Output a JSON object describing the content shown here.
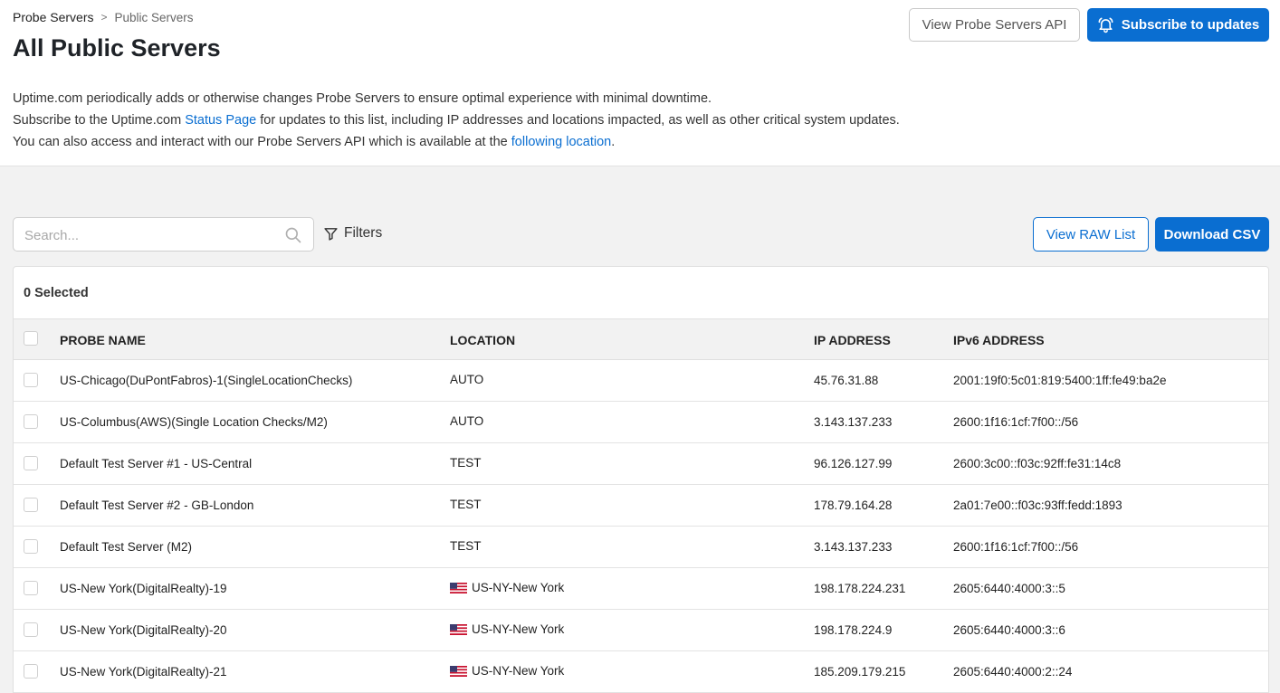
{
  "breadcrumb": {
    "root": "Probe Servers",
    "separator": ">",
    "current": "Public Servers"
  },
  "page_title": "All Public Servers",
  "header_buttons": {
    "api_label": "View Probe Servers API",
    "subscribe_label": "Subscribe to updates",
    "subscribe_icon": "bell-icon"
  },
  "intro": {
    "line1": "Uptime.com periodically adds or otherwise changes Probe Servers to ensure optimal experience with minimal downtime.",
    "line2_prefix": "Subscribe to the Uptime.com ",
    "line2_link": "Status Page",
    "line2_suffix": " for updates to this list, including IP addresses and locations impacted, as well as other critical system updates.",
    "line3_prefix": "You can also access and interact with our Probe Servers API which is available at the ",
    "line3_link": "following location",
    "line3_suffix": "."
  },
  "toolbar": {
    "search_placeholder": "Search...",
    "filters_label": "Filters",
    "raw_list_label": "View RAW List",
    "csv_label": "Download CSV"
  },
  "table": {
    "selected_label": "0 Selected",
    "columns": [
      "PROBE NAME",
      "LOCATION",
      "IP ADDRESS",
      "IPv6 ADDRESS"
    ],
    "rows": [
      {
        "name": "US-Chicago(DuPontFabros)-1(SingleLocationChecks)",
        "location": "AUTO",
        "flag": false,
        "ip": "45.76.31.88",
        "ipv6": "2001:19f0:5c01:819:5400:1ff:fe49:ba2e"
      },
      {
        "name": "US-Columbus(AWS)(Single Location Checks/M2)",
        "location": "AUTO",
        "flag": false,
        "ip": "3.143.137.233",
        "ipv6": "2600:1f16:1cf:7f00::/56"
      },
      {
        "name": "Default Test Server #1 - US-Central",
        "location": "TEST",
        "flag": false,
        "ip": "96.126.127.99",
        "ipv6": "2600:3c00::f03c:92ff:fe31:14c8"
      },
      {
        "name": "Default Test Server #2 - GB-London",
        "location": "TEST",
        "flag": false,
        "ip": "178.79.164.28",
        "ipv6": "2a01:7e00::f03c:93ff:fedd:1893"
      },
      {
        "name": "Default Test Server (M2)",
        "location": "TEST",
        "flag": false,
        "ip": "3.143.137.233",
        "ipv6": "2600:1f16:1cf:7f00::/56"
      },
      {
        "name": "US-New York(DigitalRealty)-19",
        "location": "US-NY-New York",
        "flag": true,
        "ip": "198.178.224.231",
        "ipv6": "2605:6440:4000:3::5"
      },
      {
        "name": "US-New York(DigitalRealty)-20",
        "location": "US-NY-New York",
        "flag": true,
        "ip": "198.178.224.9",
        "ipv6": "2605:6440:4000:3::6"
      },
      {
        "name": "US-New York(DigitalRealty)-21",
        "location": "US-NY-New York",
        "flag": true,
        "ip": "185.209.179.215",
        "ipv6": "2605:6440:4000:2::24"
      }
    ]
  },
  "colors": {
    "primary": "#0a6ed1",
    "header_bg": "#f2f2f2"
  }
}
